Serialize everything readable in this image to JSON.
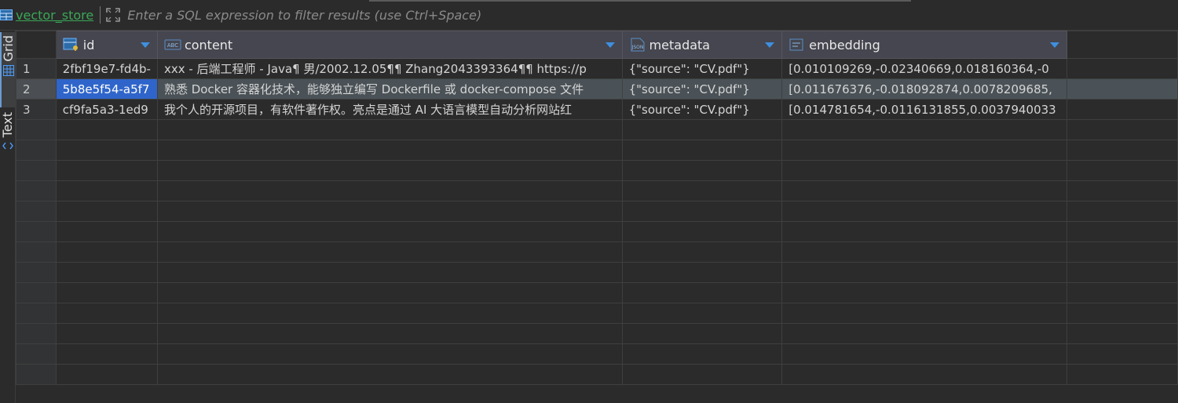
{
  "toolbar": {
    "table_name": "vector_store",
    "filter_placeholder": "Enter a SQL expression to filter results (use Ctrl+Space)"
  },
  "side_tabs": [
    {
      "label": "Grid"
    },
    {
      "label": "Text"
    }
  ],
  "columns": [
    {
      "name": "id",
      "type_icon": "key-uuid-icon"
    },
    {
      "name": "content",
      "type_icon": "text-type-icon"
    },
    {
      "name": "metadata",
      "type_icon": "json-type-icon"
    },
    {
      "name": "embedding",
      "type_icon": "vector-type-icon"
    }
  ],
  "rows": [
    {
      "num": "1",
      "id": "2fbf19e7-fd4b-",
      "content": "xxx - 后端工程师 - Java¶ 男/2002.12.05¶¶ Zhang2043393364¶¶ https://p",
      "metadata": "{\"source\": \"CV.pdf\"}",
      "embedding": "[0.010109269,-0.02340669,0.018160364,-0"
    },
    {
      "num": "2",
      "id": "5b8e5f54-a5f7",
      "content": "熟悉 Docker 容器化技术，能够独立编写 Dockerfile 或 docker-compose 文件",
      "metadata": "{\"source\": \"CV.pdf\"}",
      "embedding": "[0.011676376,-0.018092874,0.0078209685,"
    },
    {
      "num": "3",
      "id": "cf9fa5a3-1ed9",
      "content": "我个人的开源项目，有软件著作权。亮点是通过 AI 大语言模型自动分析网站红",
      "metadata": "{\"source\": \"CV.pdf\"}",
      "embedding": "[0.014781654,-0.0116131855,0.0037940033"
    }
  ],
  "selected_row": 2,
  "colors": {
    "accent": "#2f65ca",
    "table_name": "#3aa757",
    "header_bg": "#45464f",
    "background": "#2b2b2b"
  }
}
